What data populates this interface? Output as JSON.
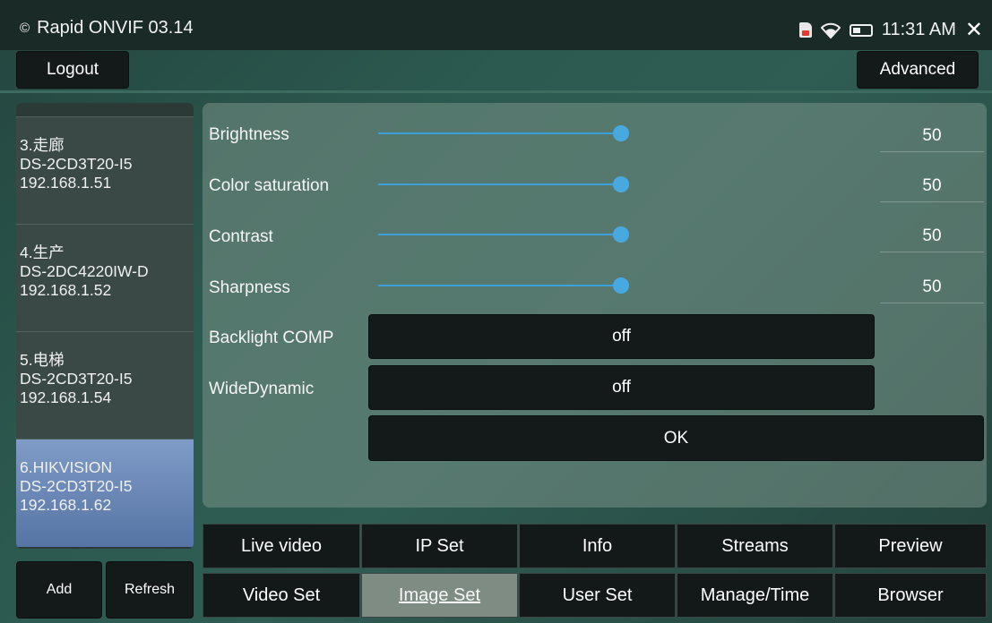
{
  "statusbar": {
    "app_title": "Rapid ONVIF 03.14",
    "time": "11:31 AM",
    "icons": [
      "copyright-icon",
      "sd-card-icon",
      "wifi-icon",
      "battery-icon",
      "close-icon"
    ]
  },
  "toolbar": {
    "logout_label": "Logout",
    "advanced_label": "Advanced"
  },
  "devices": [
    {
      "name": "3.走廊",
      "model": "DS-2CD3T20-I5",
      "ip": "192.168.1.51"
    },
    {
      "name": "4.生产",
      "model": "DS-2DC4220IW-D",
      "ip": "192.168.1.52"
    },
    {
      "name": "5.电梯",
      "model": "DS-2CD3T20-I5",
      "ip": "192.168.1.54"
    },
    {
      "name": "6.HIKVISION",
      "model": "DS-2CD3T20-I5",
      "ip": "192.168.1.62",
      "selected": true
    }
  ],
  "list_buttons": {
    "add_label": "Add",
    "refresh_label": "Refresh"
  },
  "image_settings": {
    "sliders": [
      {
        "label": "Brightness",
        "value": "50",
        "fraction": 1.0
      },
      {
        "label": "Color saturation",
        "value": "50",
        "fraction": 1.0
      },
      {
        "label": "Contrast",
        "value": "50",
        "fraction": 1.0
      },
      {
        "label": "Sharpness",
        "value": "50",
        "fraction": 1.0
      }
    ],
    "backlight_label": "Backlight COMP",
    "backlight_value": "off",
    "widedynamic_label": "WideDynamic",
    "widedynamic_value": "off",
    "ok_label": "OK"
  },
  "tabs_row1": [
    "Live video",
    "IP Set",
    "Info",
    "Streams",
    "Preview"
  ],
  "tabs_row2": [
    "Video Set",
    "Image Set",
    "User Set",
    "Manage/Time",
    "Browser"
  ],
  "active_tab": "Image Set",
  "colors": {
    "accent": "#3da0d8",
    "selected_item": "#6a88b8",
    "button_bg": "#141a19"
  }
}
